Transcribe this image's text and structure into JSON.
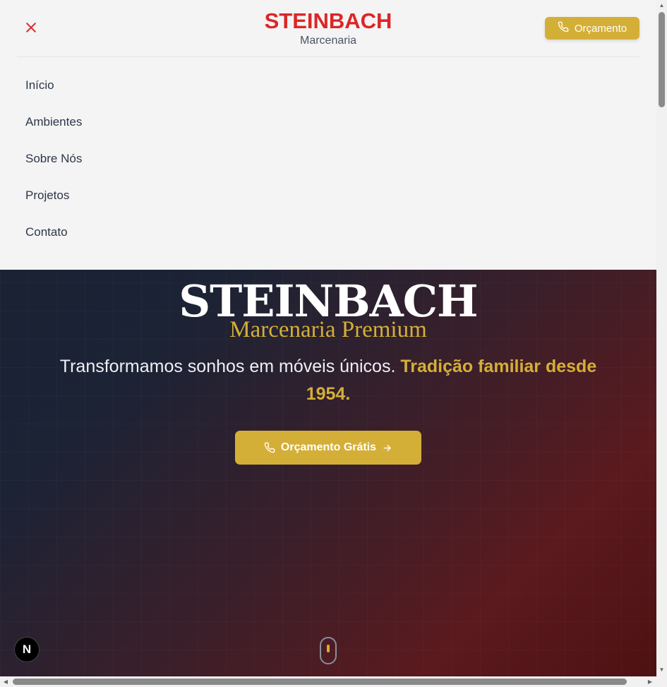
{
  "header": {
    "brand": "STEINBACH",
    "brand_sub": "Marcenaria",
    "quote_button": "Orçamento",
    "icons": {
      "close": "close-icon",
      "phone": "phone-icon"
    },
    "colors": {
      "brand_red": "#dc2626",
      "gold": "#d4af37"
    }
  },
  "nav": {
    "items": [
      {
        "label": "Início"
      },
      {
        "label": "Ambientes"
      },
      {
        "label": "Sobre Nós"
      },
      {
        "label": "Projetos"
      },
      {
        "label": "Contato"
      }
    ]
  },
  "hero": {
    "title": "STEINBACH",
    "subtitle": "Marcenaria Premium",
    "tagline_plain": "Transformamos sonhos em móveis únicos.",
    "tagline_highlight": "Tradição familiar desde 1954.",
    "cta_label": "Orçamento Grátis",
    "icons": {
      "phone": "phone-icon",
      "arrow": "arrow-right-icon",
      "scroll": "scroll-mouse-icon"
    }
  },
  "badge": {
    "letter": "N"
  }
}
